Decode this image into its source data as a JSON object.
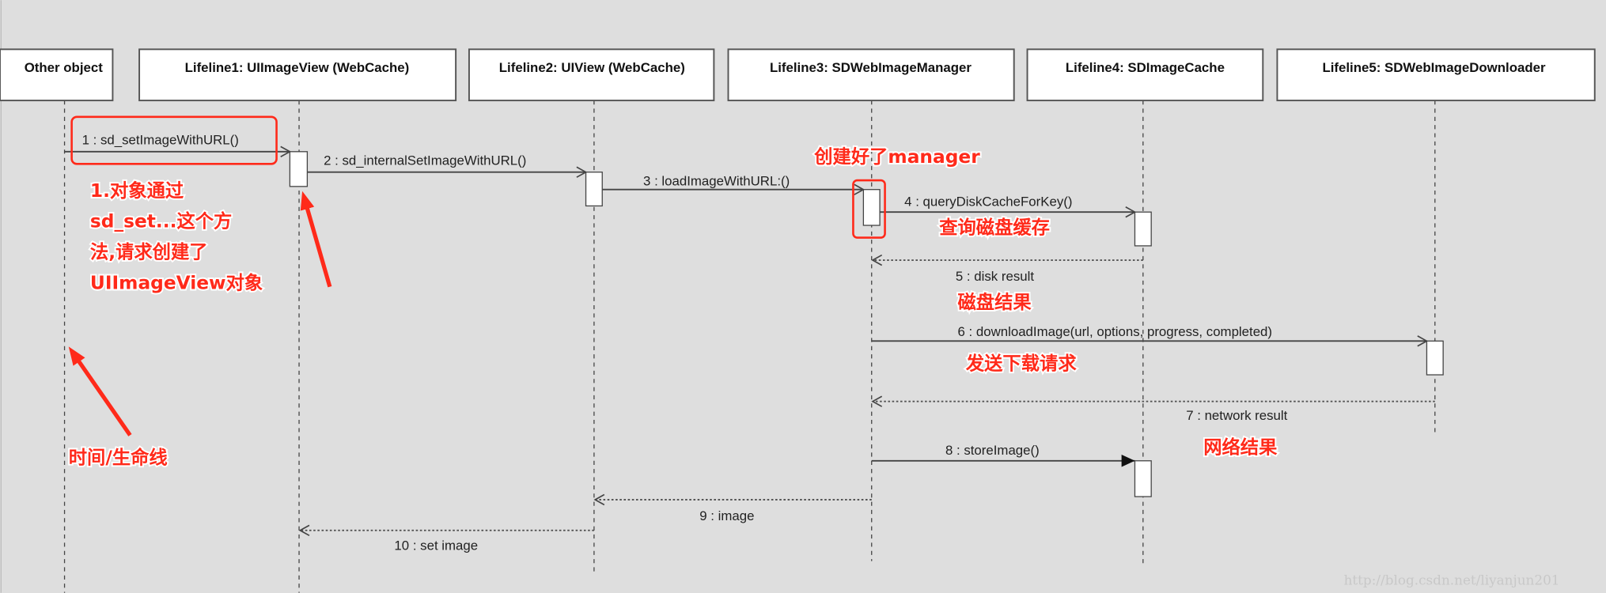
{
  "lifelines": [
    {
      "label": "Other object"
    },
    {
      "label": "Lifeline1: UIImageView (WebCache)"
    },
    {
      "label": "Lifeline2: UIView (WebCache)"
    },
    {
      "label": "Lifeline3: SDWebImageManager"
    },
    {
      "label": "Lifeline4: SDImageCache"
    },
    {
      "label": "Lifeline5: SDWebImageDownloader"
    }
  ],
  "messages": [
    {
      "label": "1 : sd_setImageWithURL()",
      "from": "Other object",
      "to": "Lifeline1",
      "kind": "call"
    },
    {
      "label": "2 : sd_internalSetImageWithURL()",
      "from": "Lifeline1",
      "to": "Lifeline2",
      "kind": "call"
    },
    {
      "label": "3 : loadImageWithURL:()",
      "from": "Lifeline2",
      "to": "Lifeline3",
      "kind": "call"
    },
    {
      "label": "4 : queryDiskCacheForKey()",
      "from": "Lifeline3",
      "to": "Lifeline4",
      "kind": "call"
    },
    {
      "label": "5 : disk result",
      "from": "Lifeline4",
      "to": "Lifeline3",
      "kind": "return"
    },
    {
      "label": "6 : downloadImage(url, options, progress, completed)",
      "from": "Lifeline3",
      "to": "Lifeline5",
      "kind": "call"
    },
    {
      "label": "7 : network result",
      "from": "Lifeline5",
      "to": "Lifeline3",
      "kind": "return"
    },
    {
      "label": "8 : storeImage()",
      "from": "Lifeline3",
      "to": "Lifeline4",
      "kind": "sync-call"
    },
    {
      "label": "9 : image",
      "from": "Lifeline3",
      "to": "Lifeline2",
      "kind": "return"
    },
    {
      "label": "10 : set image",
      "from": "Lifeline2",
      "to": "Lifeline1",
      "kind": "return"
    }
  ],
  "annotations": {
    "note1": [
      "1.对象通过",
      "sd_set...这个方",
      "法,请求创建了",
      "UIImageView对象"
    ],
    "manager": "创建好了manager",
    "query_disk": "查询磁盘缓存",
    "disk_result": "磁盘结果",
    "send_download": "发送下载请求",
    "network_result": "网络结果",
    "timeline": "时间/生命线",
    "color": "#ff2a1a"
  },
  "watermark": "http://blog.csdn.net/liyanjun201"
}
